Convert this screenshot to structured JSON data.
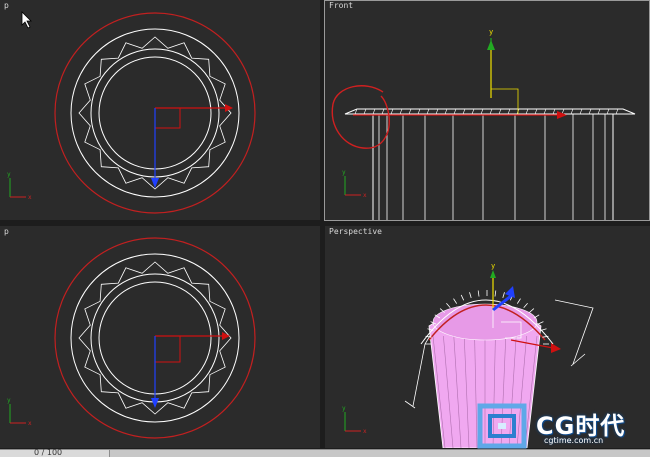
{
  "viewports": {
    "top_left": {
      "label": "p"
    },
    "front": {
      "label": "Front"
    },
    "bottom_left": {
      "label": "p"
    },
    "perspective": {
      "label": "Perspective"
    }
  },
  "axis_tripod": {
    "x_label": "x",
    "y_label": "y"
  },
  "timeline": {
    "frame_counter": "0 / 100"
  },
  "watermark": {
    "brand": "CG时代",
    "url": "cgtime.com.cn"
  },
  "colors": {
    "viewport_bg": "#2b2b2b",
    "wire": "#ffffff",
    "selection_circle": "#c22020",
    "gizmo_x": "#d01010",
    "gizmo_y": "#f0e000",
    "gizmo_z": "#2040ff",
    "object_fill": "#f0a8f0",
    "annotation": "#d02020"
  }
}
